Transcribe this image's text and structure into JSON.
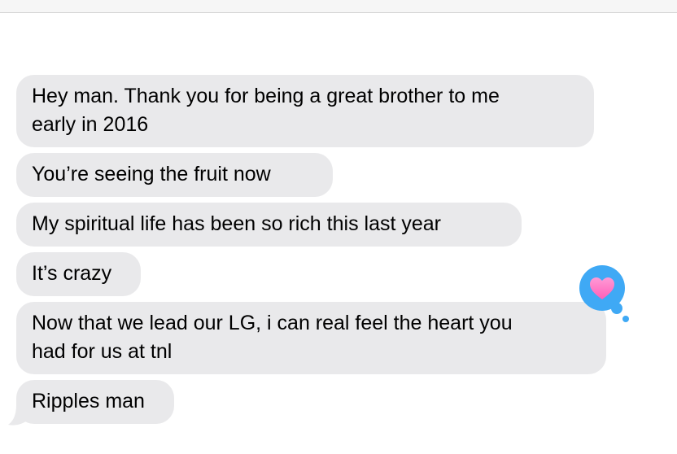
{
  "messages": [
    {
      "text_line1": "Hey man. Thank you for being a great brother to me",
      "text_line2": "early in 2016"
    },
    {
      "text": "You’re seeing the fruit now"
    },
    {
      "text": "My spiritual life has been so rich this last year"
    },
    {
      "text": "It’s crazy"
    },
    {
      "text_line1": "Now that we lead our LG, i can real feel the heart you",
      "text_line2": "had for us at tnl"
    },
    {
      "text": "Ripples man"
    }
  ],
  "reaction": {
    "icon": "heart-icon",
    "color": "#3fa9f5",
    "heart_color": "#ff7fc7"
  },
  "colors": {
    "bubble": "#e9e9eb",
    "text": "#000000"
  }
}
